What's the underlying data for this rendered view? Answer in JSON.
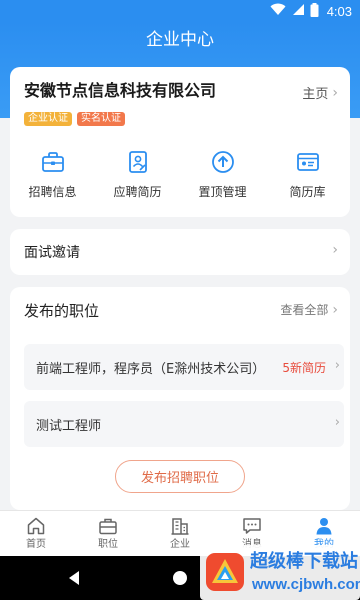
{
  "status_bar": {
    "time": "4:03"
  },
  "header": {
    "title": "企业中心"
  },
  "company": {
    "name": "安徽节点信息科技有限公司",
    "home_link": "主页",
    "badges": [
      "企业认证",
      "实名认证"
    ]
  },
  "quick_actions": [
    {
      "label": "招聘信息",
      "icon": "briefcase-icon"
    },
    {
      "label": "应聘简历",
      "icon": "resume-icon"
    },
    {
      "label": "置顶管理",
      "icon": "pin-top-icon"
    },
    {
      "label": "简历库",
      "icon": "resume-library-icon"
    }
  ],
  "interview": {
    "label": "面试邀请"
  },
  "jobs": {
    "title": "发布的职位",
    "view_all": "查看全部",
    "items": [
      {
        "title": "前端工程师，程序员（E滁州技术公司）",
        "new_count": "5新简历"
      },
      {
        "title": "测试工程师",
        "new_count": ""
      }
    ],
    "publish_button": "发布招聘职位"
  },
  "tabbar": {
    "active": 4,
    "tabs": [
      {
        "label": "首页",
        "icon": "home-icon"
      },
      {
        "label": "职位",
        "icon": "job-icon"
      },
      {
        "label": "企业",
        "icon": "building-icon"
      },
      {
        "label": "消息",
        "icon": "message-icon"
      },
      {
        "label": "我的",
        "icon": "user-icon"
      }
    ]
  },
  "watermark": {
    "text": "超级棒下载站",
    "url": "www.cjbwh.com"
  },
  "colors": {
    "brand": "#2b8ef0",
    "accent": "#e06b48",
    "new_resume": "#e84c3d"
  }
}
